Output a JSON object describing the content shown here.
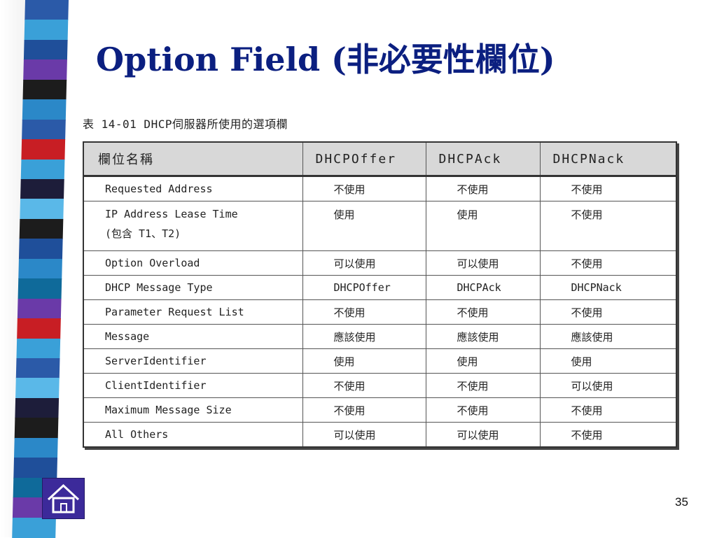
{
  "slide": {
    "title": "Option Field (非必要性欄位)",
    "page_number": "35",
    "accent_color": "#0b1f80"
  },
  "table": {
    "caption": "表 14-01  DHCP伺服器所使用的選項欄",
    "headers": [
      "欄位名稱",
      "DHCPOffer",
      "DHCPAck",
      "DHCPNack"
    ],
    "rows": [
      [
        "Requested Address",
        "不使用",
        "不使用",
        "不使用"
      ],
      [
        "IP Address Lease Time",
        "使用",
        "使用",
        "不使用"
      ],
      [
        "Option Overload",
        "可以使用",
        "可以使用",
        "不使用"
      ],
      [
        "DHCP Message Type",
        "DHCPOffer",
        "DHCPAck",
        "DHCPNack"
      ],
      [
        "Parameter Request List",
        "不使用",
        "不使用",
        "不使用"
      ],
      [
        "Message",
        "應該使用",
        "應該使用",
        "應該使用"
      ],
      [
        "ServerIdentifier",
        "使用",
        "使用",
        "使用"
      ],
      [
        "ClientIdentifier",
        "不使用",
        "不使用",
        "可以使用"
      ],
      [
        "Maximum Message Size",
        "不使用",
        "不使用",
        "不使用"
      ],
      [
        "All Others",
        "可以使用",
        "可以使用",
        "不使用"
      ]
    ],
    "row2_subline": "(包含 T1、T2)"
  },
  "home_button": {
    "icon": "home-icon"
  },
  "stripe_colors": [
    "#2b5aa8",
    "#1f4f9a",
    "#3aa0d8",
    "#1c1c1c",
    "#6a3aa8",
    "#2b88c8",
    "#c81e24",
    "#1d1d3a",
    "#5ab8e8",
    "#0f6a9a"
  ]
}
